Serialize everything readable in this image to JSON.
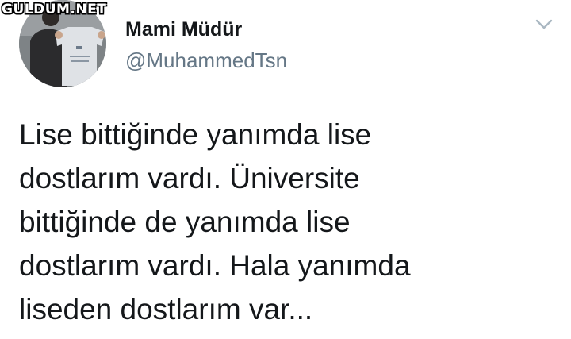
{
  "watermark": {
    "text": "GULDUM.NET"
  },
  "author": {
    "display_name": "Mami Müdür",
    "handle": "@MuhammedTsn",
    "avatar_icon": "profile-photo-person-holding-tshirt"
  },
  "menu": {
    "icon": "chevron-down-icon"
  },
  "tweet": {
    "text": "Lise bittiğinde yanımda lise\ndostlarım vardı. Üniversite\nbittiğinde de yanımda lise\ndostlarım vardı. Hala yanımda\nliseden dostlarım var..."
  },
  "colors": {
    "text_primary": "#14171a",
    "text_secondary": "#657786",
    "chevron": "#aab8c2",
    "background": "#ffffff"
  }
}
